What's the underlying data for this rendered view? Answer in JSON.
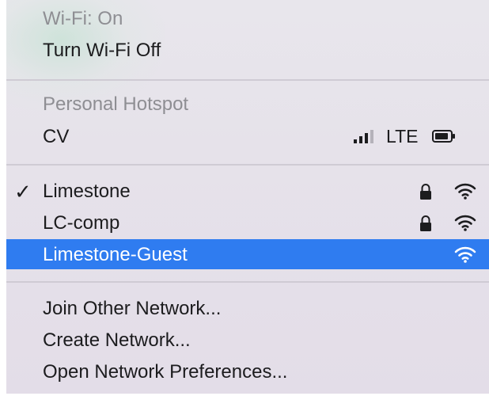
{
  "menu": {
    "wifi_status": "Wi-Fi: On",
    "turn_off": "Turn Wi-Fi Off",
    "hotspot_header": "Personal Hotspot",
    "hotspot_device": {
      "name": "CV",
      "network_type": "LTE",
      "icons": [
        "cellular-signal-icon",
        "battery-icon"
      ]
    },
    "networks": [
      {
        "name": "Limestone",
        "connected": true,
        "secured": true,
        "icon": "wifi-icon"
      },
      {
        "name": "LC-comp",
        "connected": false,
        "secured": true,
        "icon": "wifi-icon"
      },
      {
        "name": "Limestone-Guest",
        "connected": false,
        "secured": false,
        "highlighted": true,
        "icon": "wifi-icon"
      }
    ],
    "checkmark": "✓",
    "actions": [
      {
        "label": "Join Other Network..."
      },
      {
        "label": "Create Network..."
      },
      {
        "label": "Open Network Preferences..."
      }
    ]
  },
  "colors": {
    "highlight": "#2f7cf0",
    "text": "#1c1c1e",
    "dim_text": "#8e8e93"
  }
}
